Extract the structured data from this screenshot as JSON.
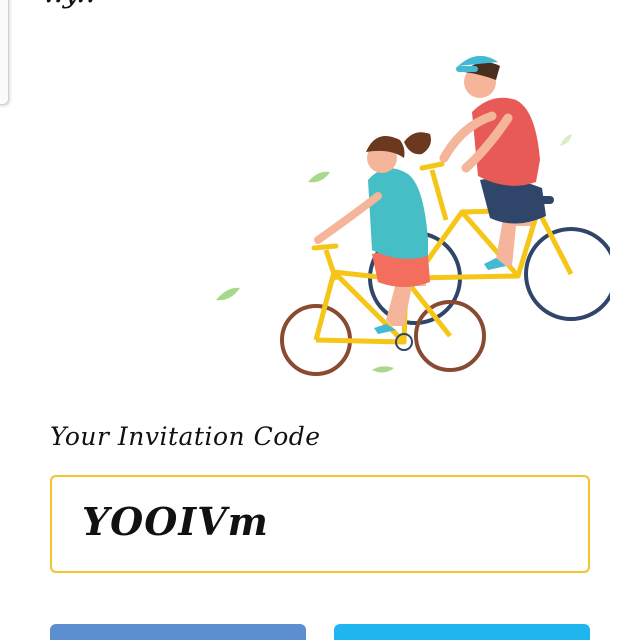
{
  "header": {
    "title_fragment": "..y.."
  },
  "illustration": {
    "name": "couple-cycling-illustration"
  },
  "invitation": {
    "label": "Your Invitation Code",
    "code": "YOOIVm"
  },
  "buttons": {
    "left_color": "#5b8fcf",
    "right_color": "#1fb6f0"
  },
  "colors": {
    "accent_border": "#f2c230",
    "bike_frame": "#f5c518"
  }
}
